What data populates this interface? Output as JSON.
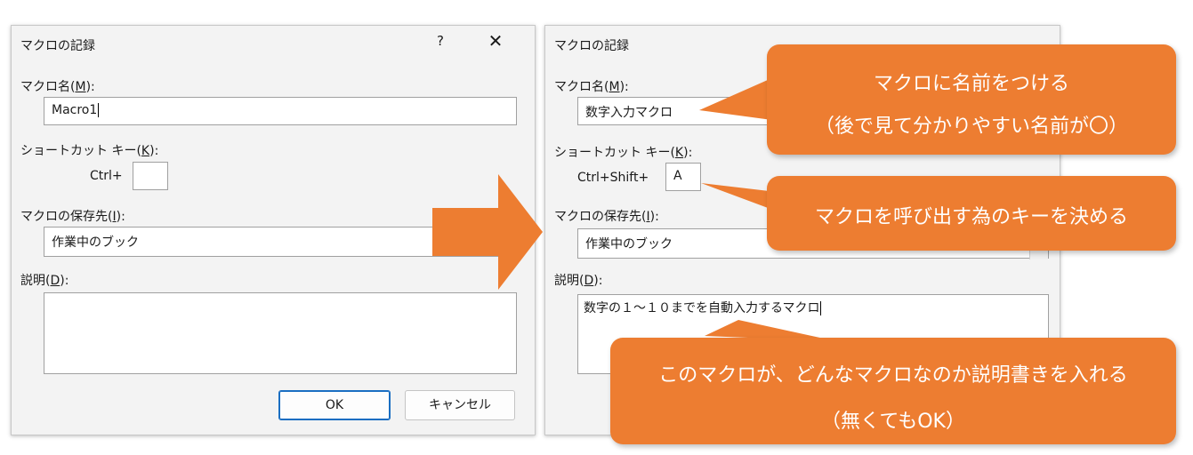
{
  "left_dialog": {
    "title": "マクロの記録",
    "help_glyph": "?",
    "close_glyph": "✕",
    "macro_name": {
      "label_pre": "マクロ名(",
      "label_key": "M",
      "label_post": "):",
      "value": "Macro1"
    },
    "shortcut": {
      "label_pre": "ショートカット キー(",
      "label_key": "K",
      "label_post": "):",
      "prefix": "Ctrl+",
      "value": ""
    },
    "store_in": {
      "label_pre": "マクロの保存先(",
      "label_key": "I",
      "label_post": "):",
      "value": "作業中のブック"
    },
    "description": {
      "label_pre": "説明(",
      "label_key": "D",
      "label_post": "):",
      "value": ""
    },
    "ok_label": "OK",
    "cancel_label": "キャンセル"
  },
  "right_dialog": {
    "title": "マクロの記録",
    "macro_name": {
      "label_pre": "マクロ名(",
      "label_key": "M",
      "label_post": "):",
      "value": "数字入力マクロ"
    },
    "shortcut": {
      "label_pre": "ショートカット キー(",
      "label_key": "K",
      "label_post": "):",
      "prefix": "Ctrl+Shift+",
      "value": "A"
    },
    "store_in": {
      "label_pre": "マクロの保存先(",
      "label_key": "I",
      "label_post": "):",
      "value": "作業中のブック"
    },
    "description": {
      "label_pre": "説明(",
      "label_key": "D",
      "label_post": "):",
      "value": "数字の１～１０までを自動入力するマクロ"
    }
  },
  "callouts": {
    "name": {
      "line1": "マクロに名前をつける",
      "line2": "（後で見て分かりやすい名前が〇）"
    },
    "key": {
      "line1": "マクロを呼び出す為のキーを決める"
    },
    "description": {
      "line1": "このマクロが、どんなマクロなのか説明書きを入れる",
      "line2": "（無くてもOK）"
    }
  },
  "colors": {
    "callout": "#ed7d31",
    "arrow": "#ed7d31",
    "dialog_bg": "#f3f3f3",
    "ok_border": "#1a6ec2"
  }
}
